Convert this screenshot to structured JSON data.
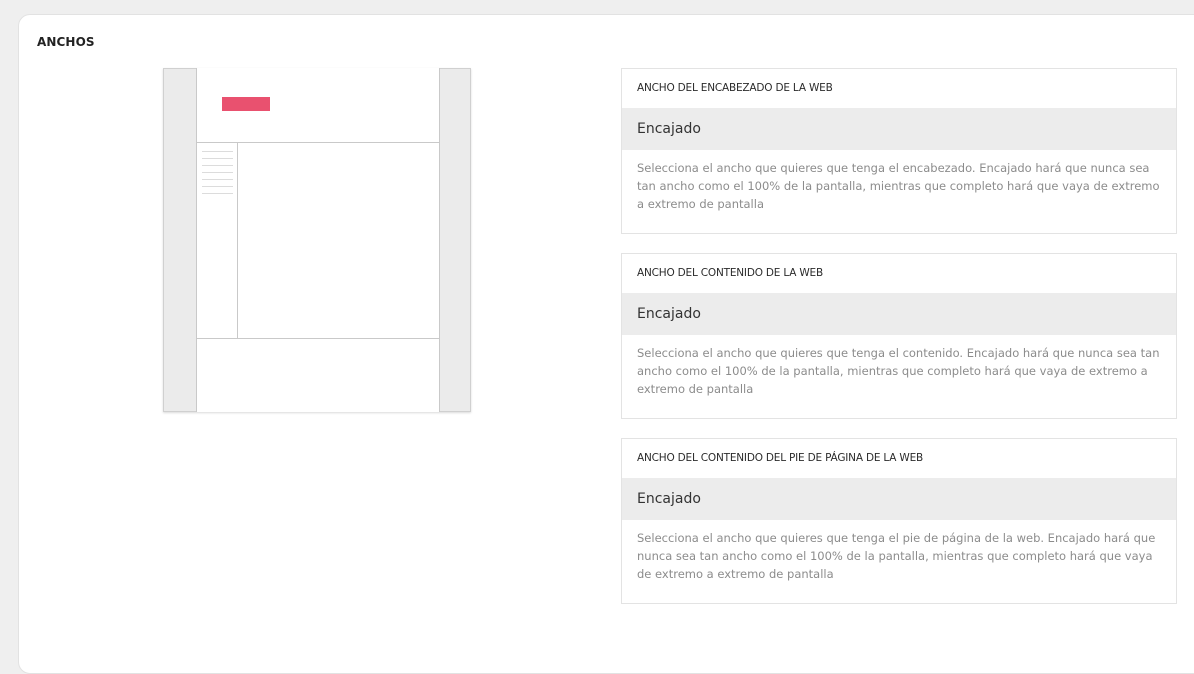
{
  "section": {
    "title": "ANCHOS"
  },
  "colors": {
    "accent_logo": "#e9516f",
    "select_bg": "#ececec",
    "desc_text": "#8c8c8c"
  },
  "settings": [
    {
      "label": "ANCHO DEL ENCABEZADO DE LA WEB",
      "value": "Encajado",
      "description": "Selecciona el ancho que quieres que tenga el encabezado. Encajado hará que nunca sea tan ancho como el 100% de la pantalla, mientras que completo hará que vaya de extremo a extremo de pantalla"
    },
    {
      "label": "ANCHO DEL CONTENIDO DE LA WEB",
      "value": "Encajado",
      "description": "Selecciona el ancho que quieres que tenga el contenido. Encajado hará que nunca sea tan ancho como el 100% de la pantalla, mientras que completo hará que vaya de extremo a extremo de pantalla"
    },
    {
      "label": "ANCHO DEL CONTENIDO DEL PIE DE PÁGINA DE LA WEB",
      "value": "Encajado",
      "description": "Selecciona el ancho que quieres que tenga el pie de página de la web. Encajado hará que nunca sea tan ancho como el 100% de la pantalla, mientras que completo hará que vaya de extremo a extremo de pantalla"
    }
  ]
}
